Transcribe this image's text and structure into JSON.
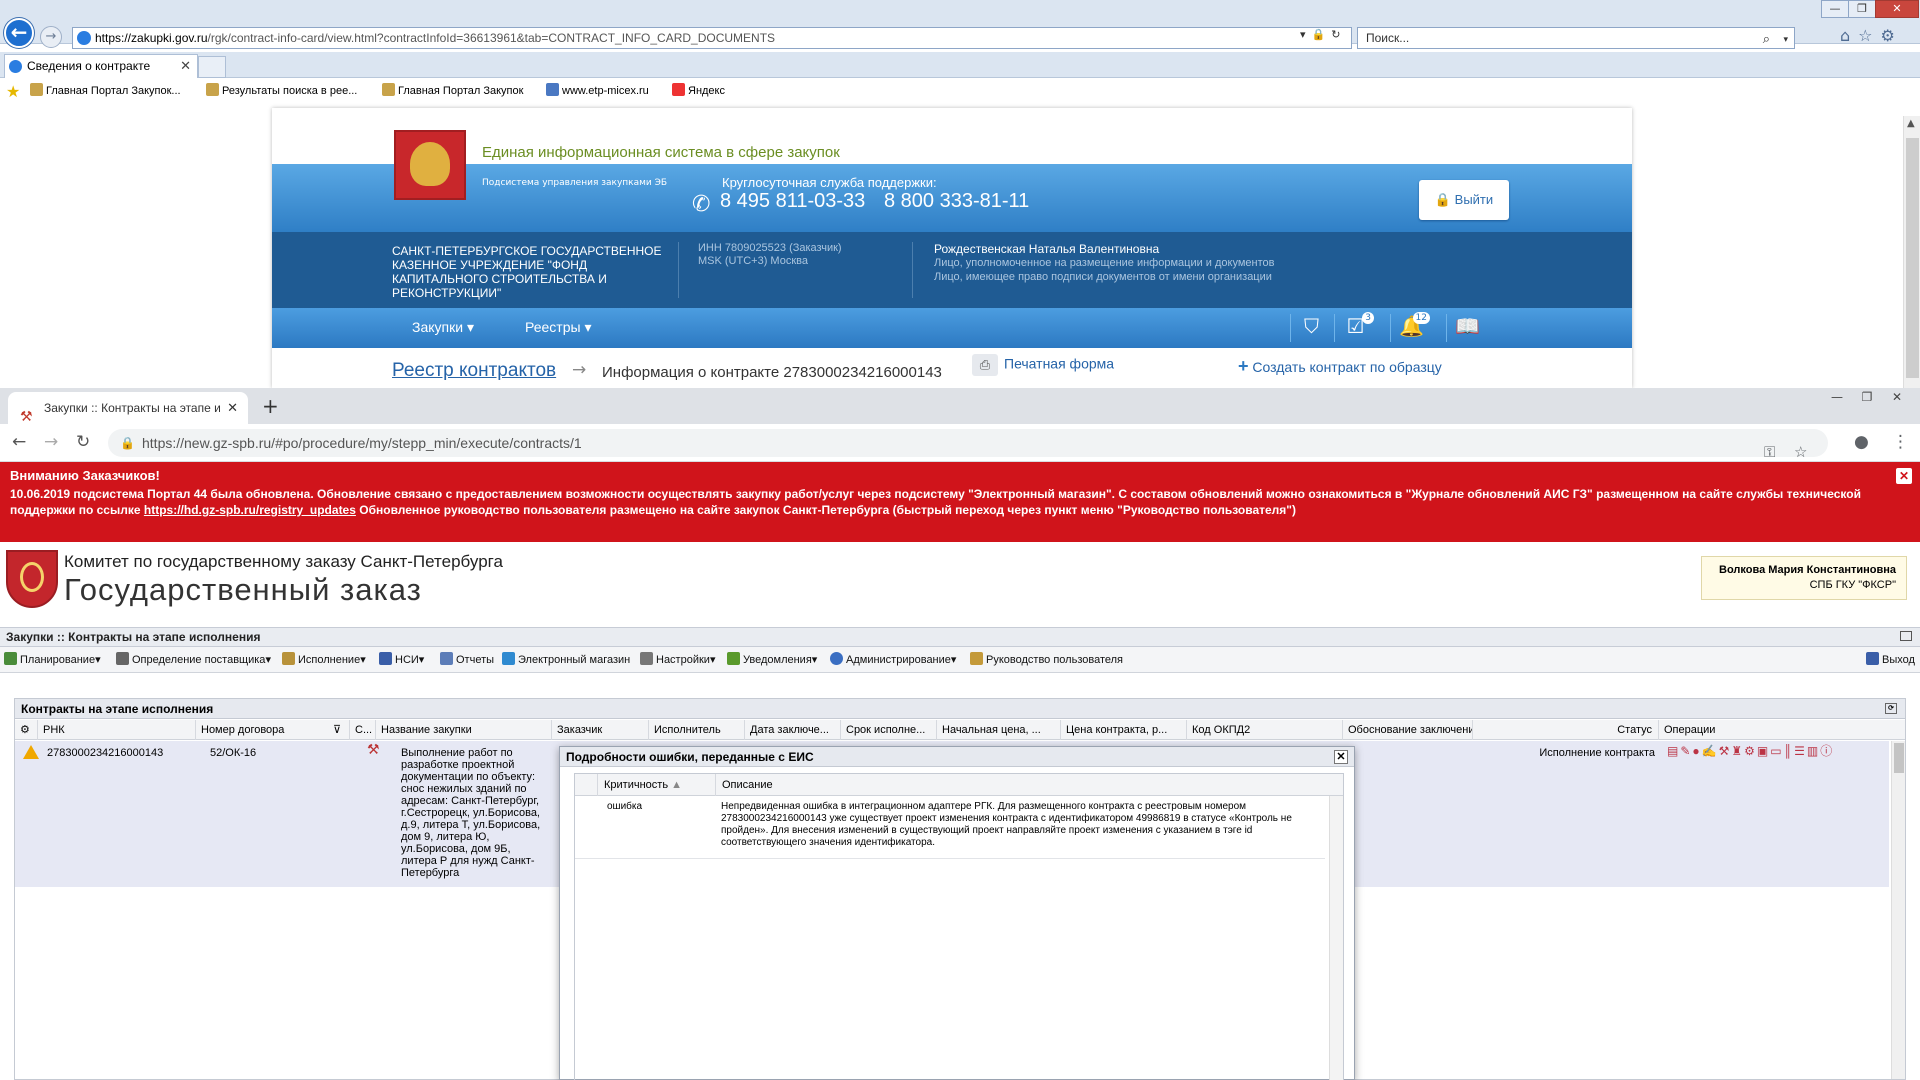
{
  "ie": {
    "url_domain": "https://zakupki.gov.ru",
    "url_path": "/rgk/contract-info-card/view.html?contractInfoId=36613961&tab=CONTRACT_INFO_CARD_DOCUMENTS",
    "search_placeholder": "Поиск...",
    "tab_title": "Сведения о контракте",
    "favorites": [
      {
        "label": "Главная Портал Закупок..."
      },
      {
        "label": "Результаты поиска в рее..."
      },
      {
        "label": "Главная Портал Закупок"
      },
      {
        "label": "www.etp-micex.ru"
      },
      {
        "label": "Яндекс"
      }
    ]
  },
  "eis": {
    "site_title": "Единая информационная система в сфере закупок",
    "subsystem": "Подсистема управления закупками ЭБ",
    "support_label": "Круглосуточная служба поддержки:",
    "phone1": "8 495 811-03-33",
    "phone2": "8 800 333-81-11",
    "logout_label": "Выйти",
    "org_name": "САНКТ-ПЕТЕРБУРГСКОЕ ГОСУДАРСТВЕННОЕ КАЗЕННОЕ УЧРЕЖДЕНИЕ \"ФОНД КАПИТАЛЬНОГО СТРОИТЕЛЬСТВА И РЕКОНСТРУКЦИИ\"",
    "inn": "ИНН 7809025523 (Заказчик)",
    "timezone": "MSK (UTC+3) Москва",
    "user_name": "Рождественская Наталья Валентиновна",
    "user_role1": "Лицо, уполномоченное на размещение информации и документов",
    "user_role2": "Лицо, имеющее право подписи документов от имени организации",
    "menu": [
      "Закупки",
      "Реестры"
    ],
    "badge_tasks": "3",
    "badge_notifications": "12",
    "breadcrumb_link": "Реестр контрактов",
    "breadcrumb_current": "Информация о контракте 2783000234216000143",
    "print_label": "Печатная форма",
    "create_label": "Создать контракт по образцу"
  },
  "chrome": {
    "tab_title": "Закупки :: Контракты на этапе и",
    "url": "https://new.gz-spb.ru/#po/procedure/my/stepp_min/execute/contracts/1"
  },
  "banner": {
    "title": "Вниманию Заказчиков!",
    "text1": "10.06.2019 подсистема Портал 44 была обновлена. Обновление связано с предоставлением возможности осуществлять закупку работ/услуг через подсистему \"Электронный магазин\". С составом обновлений можно ознакомиться в \"Журнале обновлений АИС ГЗ\" размещенном на сайте службы технической поддержки по ссылке",
    "link": "https://hd.gz-spb.ru/registry_updates",
    "text2": "Обновленное руководство пользователя размещено на сайте закупок Санкт-Петербурга (быстрый переход через пункт меню \"Руководство пользователя\")"
  },
  "gz": {
    "title1": "Комитет по государственному заказу Санкт-Петербурга",
    "title2": "Государственный заказ",
    "user_name": "Волкова Мария Константиновна",
    "user_org": "СПБ ГКУ \"ФКСР\"",
    "crumb": "Закупки :: Контракты на этапе исполнения",
    "toolbar": [
      "Планирование",
      "Определение поставщика",
      "Исполнение",
      "НСИ",
      "Отчеты",
      "Электронный магазин",
      "Настройки",
      "Уведомления",
      "Администрирование",
      "Руководство пользователя"
    ],
    "exit_label": "Выход",
    "panel_title": "Контракты на этапе исполнения",
    "columns": [
      "РНК",
      "Номер договора",
      "С...",
      "Название закупки",
      "Заказчик",
      "Исполнитель",
      "Дата заключе...",
      "Срок исполне...",
      "Начальная цена, ...",
      "Цена контракта, р...",
      "Код ОКПД2",
      "Обоснование заключения",
      "Статус",
      "Операции"
    ],
    "row": {
      "rnk": "2783000234216000143",
      "number": "52/ОК-16",
      "name": "Выполнение работ по разработке проектной документации по объекту: снос нежилых зданий по адресам: Санкт-Петербург, г.Сестрорецк, ул.Борисова, д.9, литера Т, ул.Борисова, дом 9, литера Ю, ул.Борисова, дом 9Б, литера Р для нужд Санкт-Петербурга",
      "status": "Исполнение контракта"
    }
  },
  "dialog": {
    "title": "Подробности ошибки, переданные с ЕИС",
    "col_criticality": "Критичность",
    "col_description": "Описание",
    "criticality": "ошибка",
    "description": "Непредвиденная ошибка в интеграционном адаптере РГК. Для размещенного контракта с реестровым номером 2783000234216000143 уже существует проект изменения контракта с идентификатором 49986819 в статусе «Контроль не пройден». Для внесения изменений в существующий проект направляйте проект изменения с указанием в тэге id соответствующего значения идентификатора."
  }
}
